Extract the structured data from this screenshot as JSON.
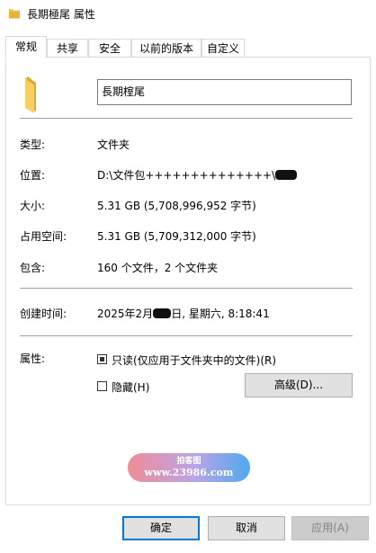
{
  "window": {
    "title": "長期極尾 属性",
    "icon": "folder-icon"
  },
  "tabs": [
    {
      "label": "常规",
      "active": true
    },
    {
      "label": "共享"
    },
    {
      "label": "安全"
    },
    {
      "label": "以前的版本"
    },
    {
      "label": "自定义"
    }
  ],
  "general": {
    "name_value": "長期榁尾",
    "type_label": "类型:",
    "type_value": "文件夹",
    "location_label": "位置:",
    "location_value": "D:\\文件包++++++++++++++\\",
    "size_label": "大小:",
    "size_value": "5.31 GB (5,708,996,952 字节)",
    "disk_label": "占用空间:",
    "disk_value": "5.31 GB (5,709,312,000 字节)",
    "contains_label": "包含:",
    "contains_value": "160 个文件，2 个文件夹",
    "created_label": "创建时间:",
    "created_prefix": "2025年2月",
    "created_suffix": "日, 星期六, 8:18:41",
    "attributes_label": "属性:",
    "readonly_label": "只读(仅应用于文件夹中的文件)(R)",
    "readonly_checked": "indeterminate",
    "hidden_label": "隐藏(H)",
    "hidden_checked": false,
    "advanced_button": "高级(D)..."
  },
  "watermark": {
    "line1": "拍客图",
    "line2": "www.23986.com"
  },
  "footer": {
    "ok": "确定",
    "cancel": "取消",
    "apply": "应用(A)"
  },
  "colors": {
    "accent": "#0078d7",
    "folder": "#f4c65a"
  }
}
